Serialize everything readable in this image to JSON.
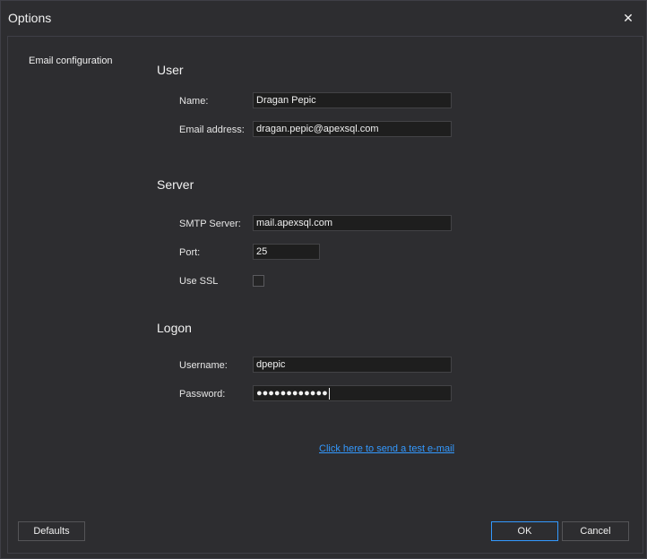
{
  "window": {
    "title": "Options"
  },
  "nav": {
    "items": [
      {
        "label": "Email configuration"
      }
    ]
  },
  "sections": {
    "user": {
      "title": "User",
      "name_label": "Name:",
      "name_value": "Dragan Pepic",
      "email_label": "Email address:",
      "email_value": "dragan.pepic@apexsql.com"
    },
    "server": {
      "title": "Server",
      "smtp_label": "SMTP Server:",
      "smtp_value": "mail.apexsql.com",
      "port_label": "Port:",
      "port_value": "25",
      "ssl_label": "Use SSL",
      "ssl_checked": false
    },
    "logon": {
      "title": "Logon",
      "username_label": "Username:",
      "username_value": "dpepic",
      "password_label": "Password:",
      "password_masked": "●●●●●●●●●●●●"
    }
  },
  "test_link": "Click here to send a test e-mail",
  "buttons": {
    "defaults": "Defaults",
    "ok": "OK",
    "cancel": "Cancel"
  },
  "icons": {
    "close": "close-icon"
  }
}
